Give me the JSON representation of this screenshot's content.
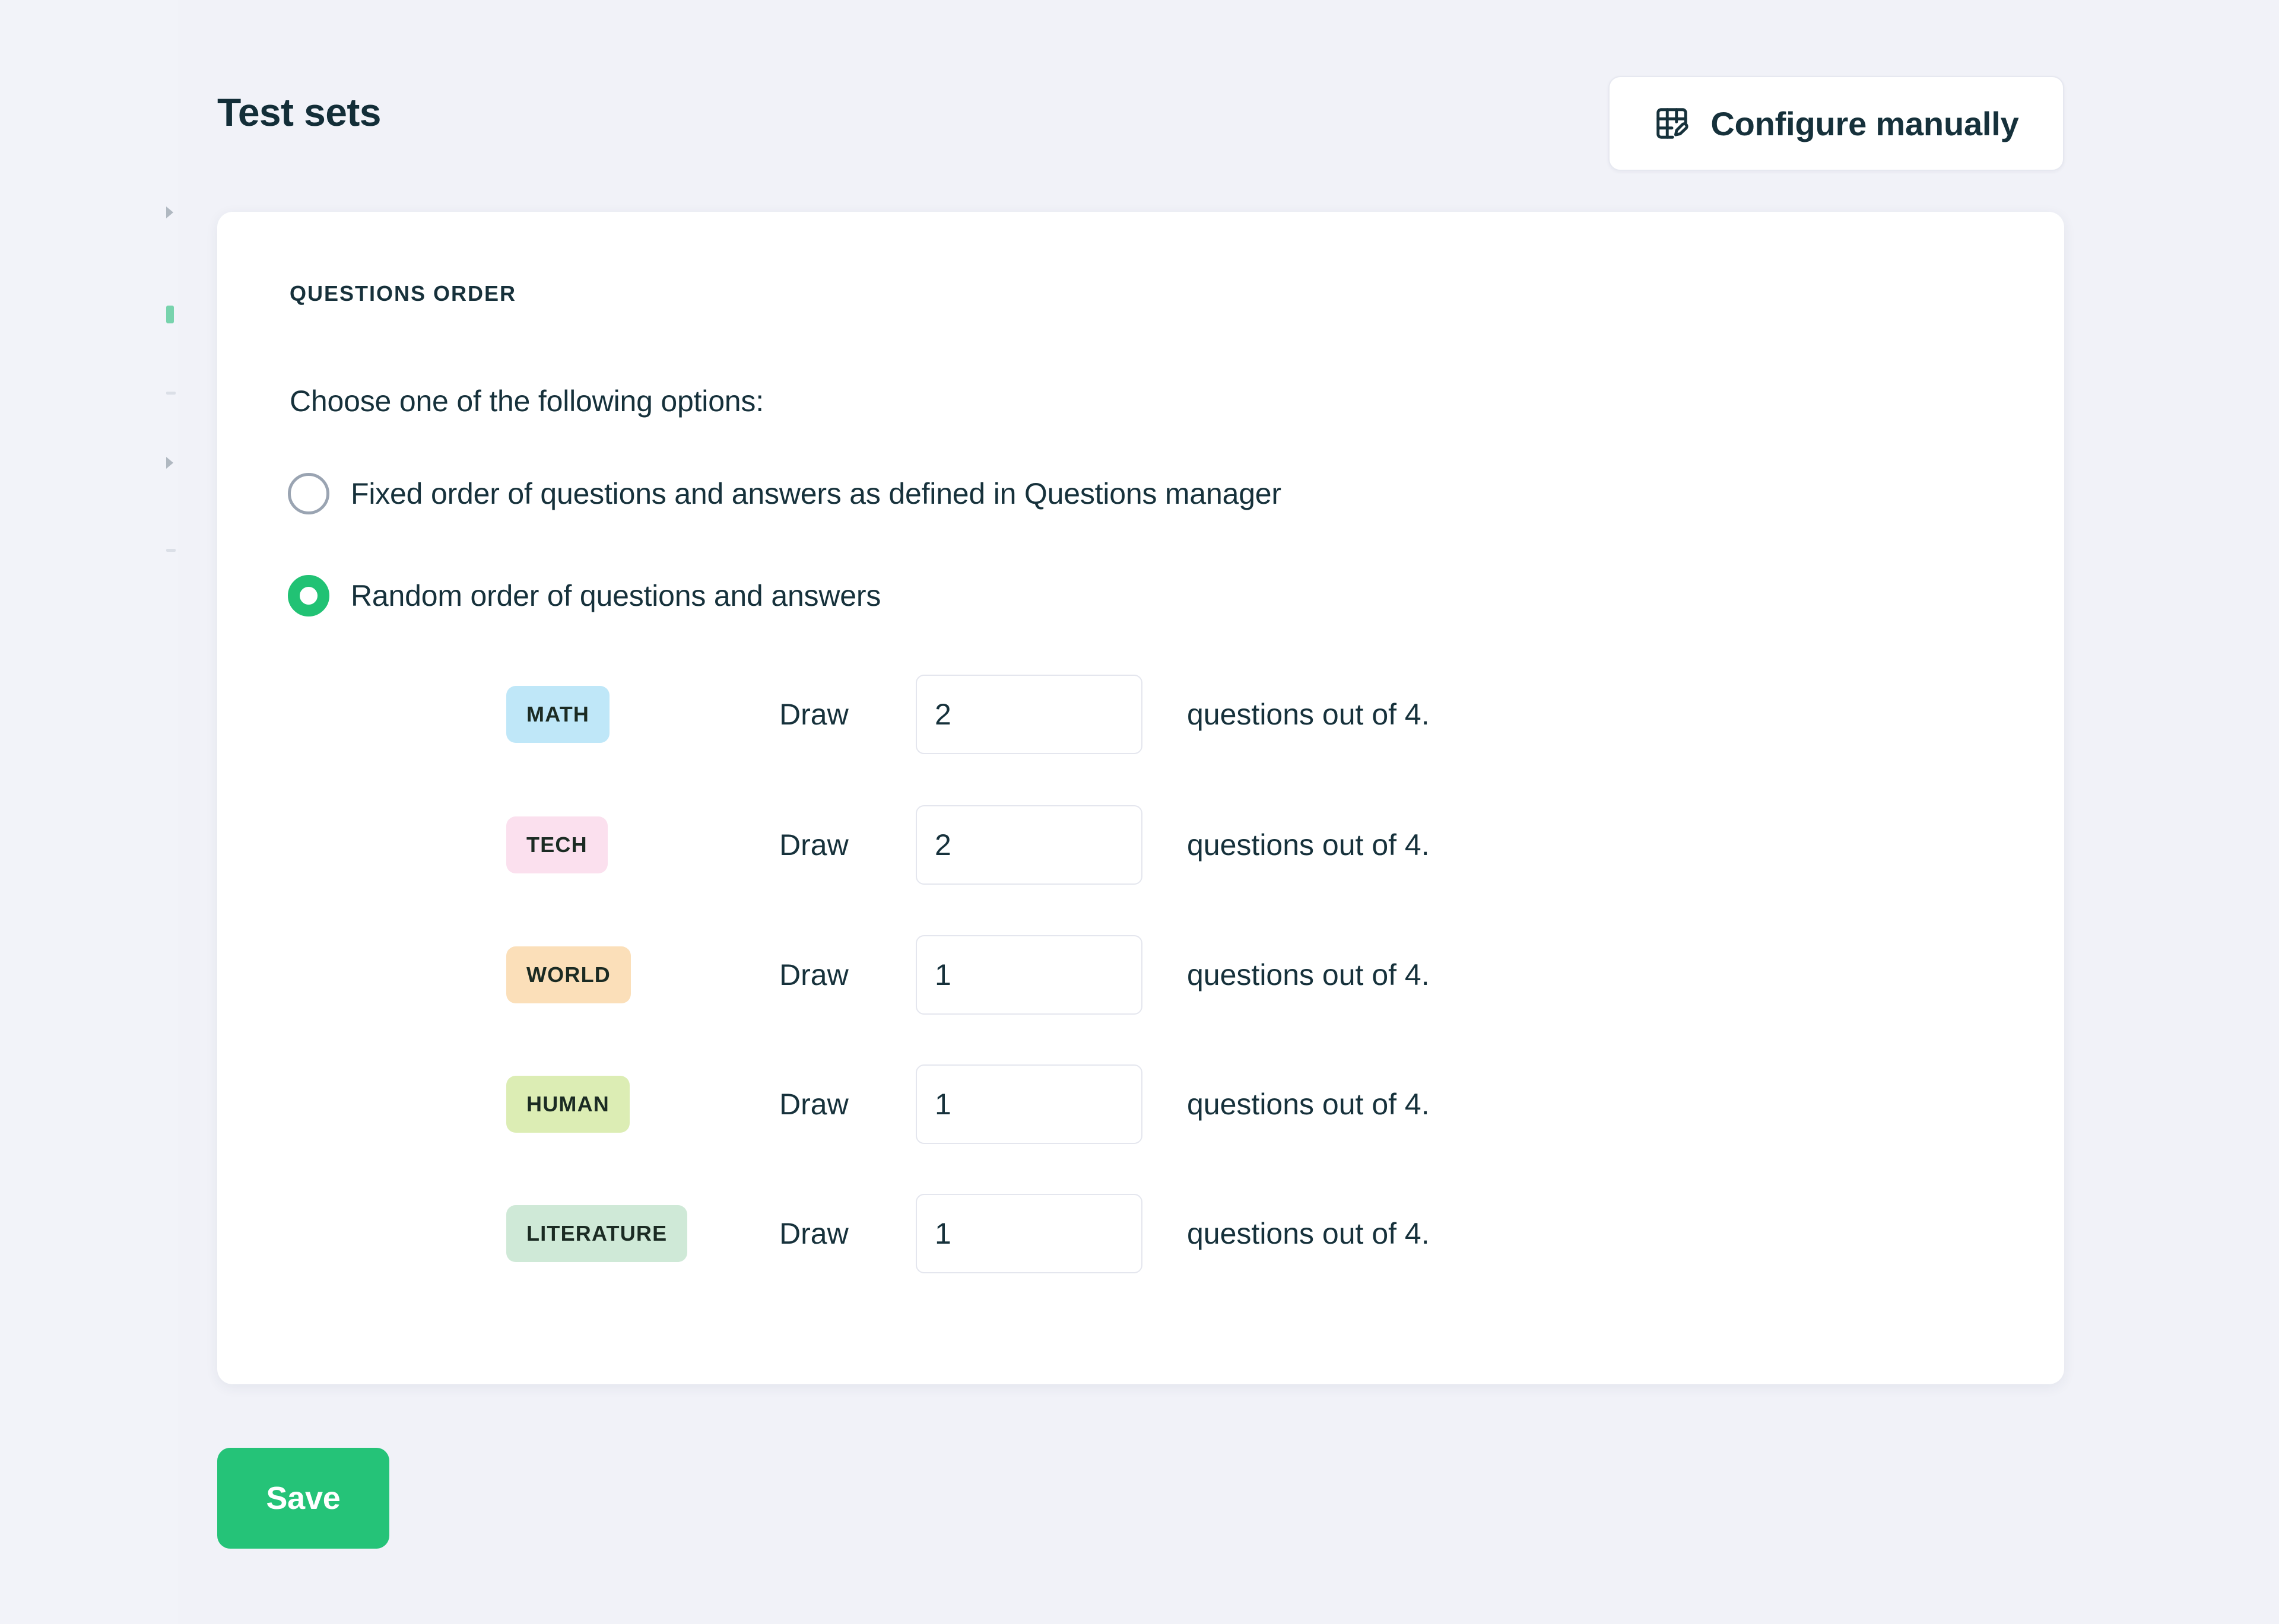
{
  "header": {
    "title": "Test sets",
    "configure_button_label": "Configure manually",
    "configure_button_icon": "grid-edit-icon"
  },
  "card": {
    "section_label": "QUESTIONS ORDER",
    "instruction": "Choose one of the following options:",
    "options": [
      {
        "label": "Fixed order of questions and answers as defined in Questions manager",
        "selected": false
      },
      {
        "label": "Random order of questions and answers",
        "selected": true
      }
    ],
    "draw_rows": [
      {
        "tag": "MATH",
        "tag_color": "#bfe7f8",
        "draw_label": "Draw",
        "value": "2",
        "suffix": "questions out of 4."
      },
      {
        "tag": "TECH",
        "tag_color": "#fbe0ee",
        "draw_label": "Draw",
        "value": "2",
        "suffix": "questions out of 4."
      },
      {
        "tag": "WORLD",
        "tag_color": "#fbdfb9",
        "draw_label": "Draw",
        "value": "1",
        "suffix": "questions out of 4."
      },
      {
        "tag": "HUMAN",
        "tag_color": "#dcedb4",
        "draw_label": "Draw",
        "value": "1",
        "suffix": "questions out of 4."
      },
      {
        "tag": "LITERATURE",
        "tag_color": "#cfe9d7",
        "draw_label": "Draw",
        "value": "1",
        "suffix": "questions out of 4."
      }
    ]
  },
  "footer": {
    "save_label": "Save"
  },
  "colors": {
    "page_background": "#f1f2f8",
    "card_background": "#ffffff",
    "accent_green": "#25c378",
    "radio_selected": "#21c274",
    "text_primary": "#16313b",
    "input_border": "#e4e6ee"
  }
}
